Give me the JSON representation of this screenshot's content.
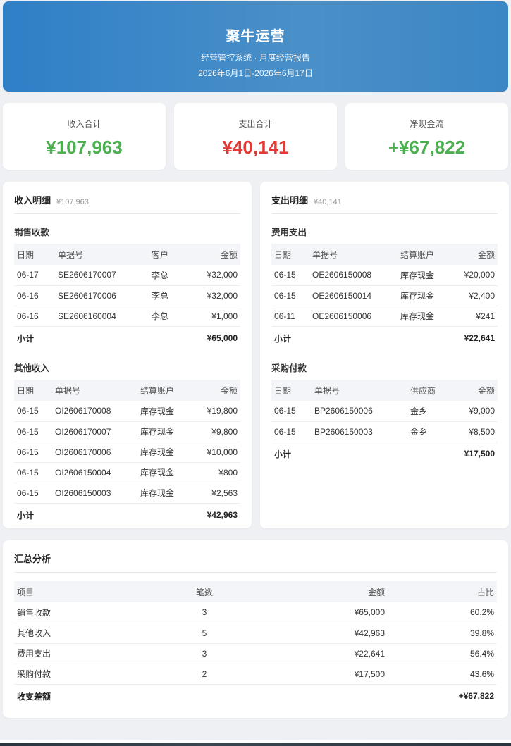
{
  "header": {
    "title": "聚牛运营",
    "subtitle": "经营管控系统 · 月度经营报告",
    "date_range": "2026年6月1日-2026年6月17日"
  },
  "stats": [
    {
      "label": "收入合计",
      "value": "¥107,963",
      "color": "#4caf50"
    },
    {
      "label": "支出合计",
      "value": "¥40,141",
      "color": "#e53935"
    },
    {
      "label": "净现金流",
      "value": "+¥67,822",
      "color": "#4caf50"
    }
  ],
  "income": {
    "title": "收入明细",
    "total": "¥107,963",
    "sales": {
      "title": "销售收款",
      "columns": [
        "日期",
        "单据号",
        "客户",
        "金额"
      ],
      "rows": [
        [
          "06-17",
          "SE2606170007",
          "李总",
          "¥32,000"
        ],
        [
          "06-16",
          "SE2606170006",
          "李总",
          "¥32,000"
        ],
        [
          "06-16",
          "SE2606160004",
          "李总",
          "¥1,000"
        ]
      ],
      "subtotal_label": "小计",
      "subtotal": "¥65,000"
    },
    "other": {
      "title": "其他收入",
      "columns": [
        "日期",
        "单据号",
        "结算账户",
        "金额"
      ],
      "rows": [
        [
          "06-15",
          "OI2606170008",
          "库存现金",
          "¥19,800"
        ],
        [
          "06-15",
          "OI2606170007",
          "库存现金",
          "¥9,800"
        ],
        [
          "06-15",
          "OI2606170006",
          "库存现金",
          "¥10,000"
        ],
        [
          "06-15",
          "OI2606150004",
          "库存现金",
          "¥800"
        ],
        [
          "06-15",
          "OI2606150003",
          "库存现金",
          "¥2,563"
        ]
      ],
      "subtotal_label": "小计",
      "subtotal": "¥42,963"
    }
  },
  "expense": {
    "title": "支出明细",
    "total": "¥40,141",
    "costs": {
      "title": "费用支出",
      "columns": [
        "日期",
        "单据号",
        "结算账户",
        "金额"
      ],
      "rows": [
        [
          "06-15",
          "OE2606150008",
          "库存现金",
          "¥20,000"
        ],
        [
          "06-15",
          "OE2606150014",
          "库存现金",
          "¥2,400"
        ],
        [
          "06-11",
          "OE2606150006",
          "库存现金",
          "¥241"
        ]
      ],
      "subtotal_label": "小计",
      "subtotal": "¥22,641"
    },
    "purchase": {
      "title": "采购付款",
      "columns": [
        "日期",
        "单据号",
        "供应商",
        "金额"
      ],
      "rows": [
        [
          "06-15",
          "BP2606150006",
          "金乡",
          "¥9,000"
        ],
        [
          "06-15",
          "BP2606150003",
          "金乡",
          "¥8,500"
        ]
      ],
      "subtotal_label": "小计",
      "subtotal": "¥17,500"
    }
  },
  "summary": {
    "title": "汇总分析",
    "columns": [
      "项目",
      "笔数",
      "金额",
      "占比"
    ],
    "rows": [
      [
        "销售收款",
        "3",
        "¥65,000",
        "60.2%"
      ],
      [
        "其他收入",
        "5",
        "¥42,963",
        "39.8%"
      ],
      [
        "费用支出",
        "3",
        "¥22,641",
        "56.4%"
      ],
      [
        "采购付款",
        "2",
        "¥17,500",
        "43.6%"
      ]
    ],
    "footer_label": "收支差额",
    "footer_value": "+¥67,822"
  }
}
